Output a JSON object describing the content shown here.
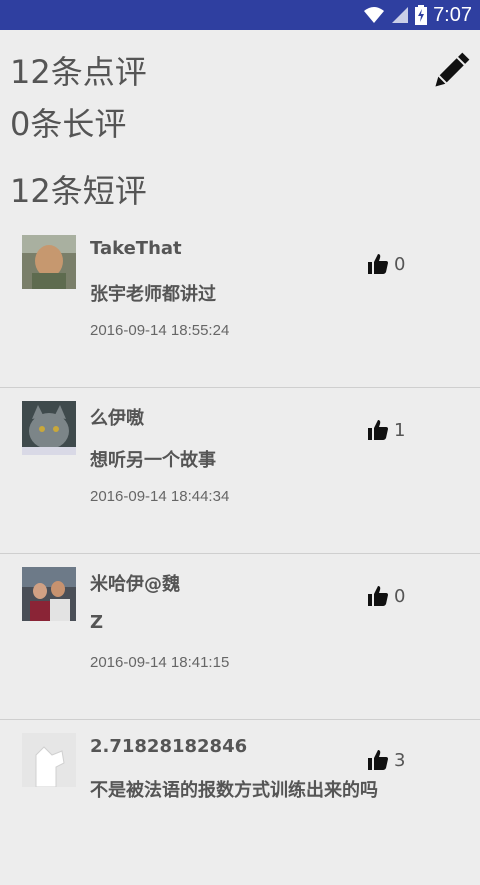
{
  "status": {
    "time": "7:07"
  },
  "summary": {
    "total_reviews": "12条点评",
    "long_reviews": "0条长评",
    "short_reviews": "12条短评"
  },
  "reviews": [
    {
      "name": "TakeThat",
      "content": "张宇老师都讲过",
      "time": "2016-09-14 18:55:24",
      "likes": "0"
    },
    {
      "name": "么伊嗷",
      "content": "想听另一个故事",
      "time": "2016-09-14 18:44:34",
      "likes": "1"
    },
    {
      "name": "米哈伊@魏",
      "content": "Z",
      "time": "2016-09-14 18:41:15",
      "likes": "0"
    },
    {
      "name": "2.71828182846",
      "content": "不是被法语的报数方式训练出来的吗",
      "time": "",
      "likes": "3"
    }
  ],
  "icons": {
    "status": [
      "wifi-icon",
      "signal-icon",
      "battery-charging-icon"
    ],
    "compose": "pencil-icon",
    "like": "thumbs-up-icon"
  }
}
